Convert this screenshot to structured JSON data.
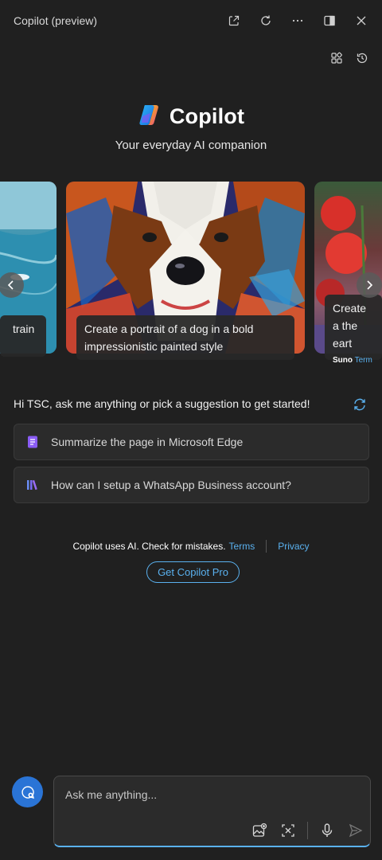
{
  "titlebar": {
    "title": "Copilot (preview)",
    "icons": [
      "open-in-new-icon",
      "refresh-icon",
      "more-icon",
      "sidebar-icon",
      "close-icon"
    ]
  },
  "toolbar": {
    "icons": [
      "plugins-icon",
      "history-icon"
    ]
  },
  "brand": {
    "name": "Copilot",
    "tagline": "Your everyday AI companion"
  },
  "carousel": {
    "cards": [
      {
        "caption": "train"
      },
      {
        "caption": "Create a portrait of a dog in a bold impressionistic painted style"
      },
      {
        "caption": "Create a the eart",
        "attribution": "Suno",
        "attribution_link": "Term"
      }
    ]
  },
  "greeting": "Hi TSC, ask me anything or pick a suggestion to get started!",
  "suggestions": [
    {
      "label": "Summarize the page in Microsoft Edge",
      "icon": "document-icon"
    },
    {
      "label": "How can I setup a WhatsApp Business account?",
      "icon": "library-icon"
    }
  ],
  "disclaimer": {
    "text": "Copilot uses AI. Check for mistakes.",
    "terms": "Terms",
    "privacy": "Privacy"
  },
  "pro_button": "Get Copilot Pro",
  "composer": {
    "placeholder": "Ask me anything..."
  },
  "colors": {
    "background": "#202020",
    "accent": "#5ab1ef",
    "new_topic": "#2a74d6"
  }
}
